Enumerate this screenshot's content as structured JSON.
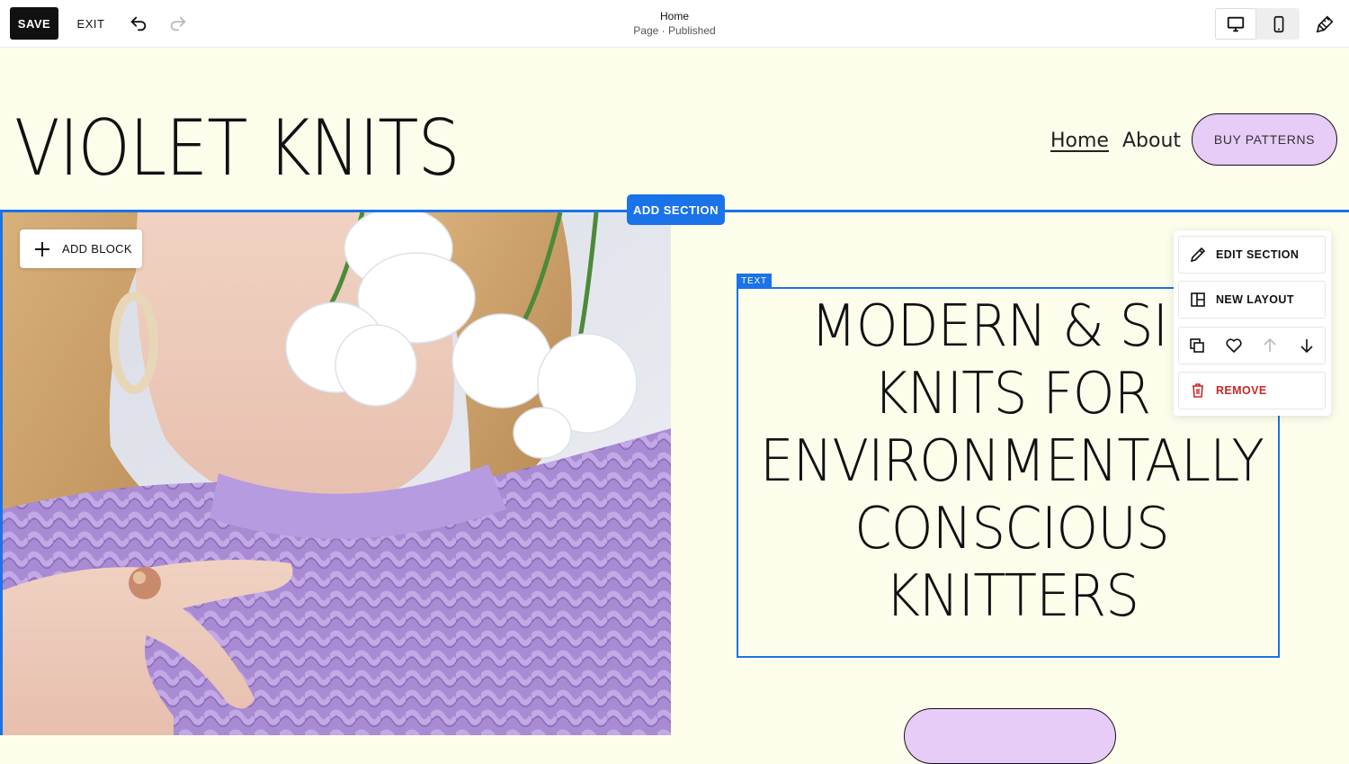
{
  "toolbar": {
    "save_label": "SAVE",
    "exit_label": "EXIT",
    "page_title": "Home",
    "page_status": "Page · Published",
    "icons": [
      "undo-icon",
      "redo-icon",
      "desktop-icon",
      "mobile-icon",
      "site-styles-icon"
    ]
  },
  "site": {
    "title": "VIOLET KNITS",
    "nav": [
      {
        "label": "Home",
        "active": true
      },
      {
        "label": "About",
        "active": false
      }
    ],
    "cta_label": "BUY PATTERNS"
  },
  "editor": {
    "add_section_label": "ADD SECTION",
    "add_block_label": "ADD BLOCK",
    "text_tag": "TEXT",
    "accent_color": "#1a73e8"
  },
  "section": {
    "headline_lines": [
      "MODERN & SIM",
      "KNITS FOR",
      "ENVIRONMENTALLY",
      "CONSCIOUS",
      "KNITTERS"
    ],
    "button_color": "#e6ccf6",
    "background_color": "#fdfdec"
  },
  "section_menu": {
    "edit_label": "EDIT SECTION",
    "layout_label": "NEW LAYOUT",
    "remove_label": "REMOVE",
    "icon_row": [
      "duplicate-icon",
      "heart-icon",
      "move-up-icon",
      "move-down-icon"
    ]
  }
}
